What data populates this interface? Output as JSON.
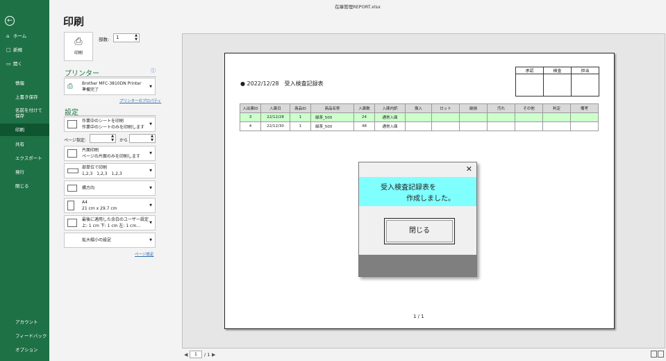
{
  "window": {
    "title": "在庫管理REPORT.xlsx"
  },
  "sidebar": {
    "back_icon": "←",
    "items": [
      {
        "label": "ホーム",
        "icon": "⌂"
      },
      {
        "label": "新規",
        "icon": "□"
      },
      {
        "label": "開く",
        "icon": "▭"
      },
      {
        "label": "情報"
      },
      {
        "label": "上書き保存"
      },
      {
        "label": "名前を付けて保存"
      },
      {
        "label": "印刷"
      },
      {
        "label": "共有"
      },
      {
        "label": "エクスポート"
      },
      {
        "label": "発行"
      },
      {
        "label": "閉じる"
      },
      {
        "label": "アカウント"
      },
      {
        "label": "フィードバック"
      },
      {
        "label": "オプション"
      }
    ]
  },
  "print_panel": {
    "heading": "印刷",
    "print_button": "印刷",
    "copies_label": "部数:",
    "copies_value": "1",
    "printer_section": "プリンター",
    "printer_name": "Brother MFC-3810DN Printer",
    "printer_status": "準備完了",
    "printer_props_link": "プリンターのプロパティ",
    "settings_section": "設定",
    "sheet_range_1": "作業中のシートを印刷",
    "sheet_range_2": "作業中のシートのみを印刷します",
    "pages_label": "ページ指定:",
    "pages_to": "から",
    "sides_1": "片面印刷",
    "sides_2": "ページの片面のみを印刷します",
    "collate_1": "部単位で印刷",
    "collate_2": "1,2,3　1,2,3　1,2,3",
    "orientation": "横方向",
    "paper_1": "A4",
    "paper_2": "21 cm x 29.7 cm",
    "margins_1": "最後に適用した余白のユーザー設定",
    "margins_2": "上: 1 cm 下: 1 cm 左: 1 cm…",
    "scaling": "拡大縮小の設定",
    "page_setup_link": "ページ設定"
  },
  "report": {
    "title": "● 2022/12/28　受入検査記録表",
    "approval_headers": [
      "承認",
      "検査",
      "担当"
    ],
    "columns": [
      "入出庫ID",
      "入庫日",
      "商品ID",
      "商品名称",
      "入庫数",
      "入庫内訳",
      "振入",
      "ロット",
      "破損",
      "汚れ",
      "その他",
      "判定",
      "備考"
    ],
    "rows": [
      [
        "3",
        "22/12/28",
        "1",
        "緑茶_500",
        "24",
        "通常入庫",
        "",
        "",
        "",
        "",
        "",
        "",
        ""
      ],
      [
        "4",
        "22/12/30",
        "1",
        "緑茶_500",
        "48",
        "通常入庫",
        "",
        "",
        "",
        "",
        "",
        "",
        ""
      ]
    ],
    "page_counter": "1 / 1"
  },
  "dialog": {
    "close_icon": "✕",
    "message_line1": "受入検査記録表を",
    "message_line2": "作成しました。",
    "close_button": "閉じる"
  },
  "nav": {
    "prev": "◀",
    "next": "▶",
    "current_page": "1",
    "total": "/ 1"
  }
}
